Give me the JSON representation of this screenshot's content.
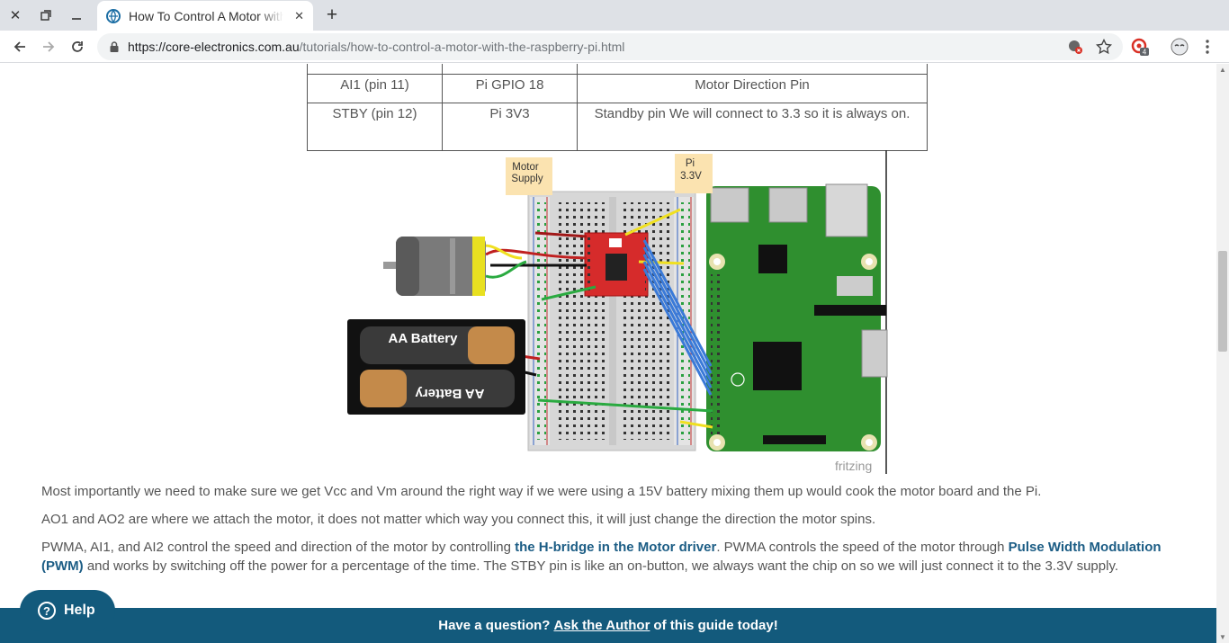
{
  "browser": {
    "tab_title": "How To Control A Motor with the Raspberry Pi",
    "url_host": "https://core-electronics.com.au",
    "url_path": "/tutorials/how-to-control-a-motor-with-the-raspberry-pi.html",
    "extension_badge": "4"
  },
  "pin_table": {
    "rows": [
      {
        "pin": "AI1 (pin 11)",
        "pi": "Pi GPIO 18",
        "desc": "Motor Direction Pin"
      },
      {
        "pin": "STBY (pin 12)",
        "pi": "Pi 3V3",
        "desc": "Standby pin We will connect to 3.3 so it is always on."
      }
    ]
  },
  "diagram": {
    "motor_supply_label_1": "Motor",
    "motor_supply_label_2": "Supply",
    "pi_label_1": "Pi",
    "pi_label_2": "3.3V",
    "battery_top": "AA Battery",
    "battery_bottom": "AA Battery",
    "fritzing": "fritzing"
  },
  "content": {
    "p1": "Most importantly we need to make sure we get Vcc and Vm around the right way if we were using a 15V battery mixing them up would cook the motor board and the Pi.",
    "p2": "AO1 and AO2 are where we attach the motor, it does not matter which way you connect this, it will just change the direction the motor spins.",
    "p3_a": "PWMA, AI1, and AI2 control the speed and direction of the motor by controlling ",
    "p3_link1": "the H-bridge in the Motor driver",
    "p3_b": ". PWMA controls the speed of the motor through ",
    "p3_link2": "Pulse Width Modulation (PWM)",
    "p3_c": " and works by switching off the power for a percentage of the time. The STBY pin is like an on-button, we always want the chip on so we will just connect it to the 3.3V supply."
  },
  "footer": {
    "pre": "Have a question?",
    "ask": "Ask the Author",
    "post": "of this guide today!",
    "help": "Help"
  },
  "colors": {
    "accent": "#135a7c",
    "link": "#1c5d85"
  }
}
